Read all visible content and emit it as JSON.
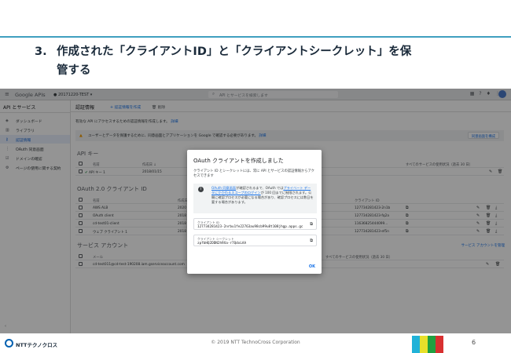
{
  "slide": {
    "title_number": "3.",
    "title_line1": "作成された「クライアントID」と「クライアントシークレット」を保",
    "title_line2": "管する"
  },
  "console": {
    "product": "Google APIs",
    "project": "20171220-TEST",
    "search_placeholder": "API とサービスを検索します",
    "sidebar": {
      "title": "API とサービス",
      "items": [
        {
          "label": "ダッシュボード",
          "icon": "dashboard-icon",
          "glyph": "◈"
        },
        {
          "label": "ライブラリ",
          "icon": "library-icon",
          "glyph": "▥"
        },
        {
          "label": "認証情報",
          "icon": "key-icon",
          "glyph": "⚷"
        },
        {
          "label": "OAuth 同意画面",
          "icon": "consent-icon",
          "glyph": "⋮"
        },
        {
          "label": "ドメインの確認",
          "icon": "checkbox-icon",
          "glyph": "☑"
        },
        {
          "label": "ページの使用に関する契約",
          "icon": "settings-icon",
          "glyph": "⚙"
        }
      ],
      "collapse_icon": "‹"
    },
    "header": {
      "title": "認証情報",
      "create": "+ 認証情報を作成",
      "delete": "🗑 削除"
    },
    "description": "有効な API にアクセスするための認証情報を作成します。",
    "description_link": "詳細",
    "notice": "ユーザーとデータを保護するために、同意画面とアプリケーションを Google で確認する必要があります。",
    "notice_link": "詳細",
    "notice_button": "同意画面を構成",
    "api_keys": {
      "title": "API キー",
      "headers": {
        "name": "名前",
        "created": "作成日 ↓",
        "restrictions": "制限",
        "usage": "すべてのサービスの使用状況（過去 30 日）"
      },
      "rows": [
        {
          "name": "API キー 1",
          "created": "2018/01/15"
        }
      ]
    },
    "oauth": {
      "title": "OAuth 2.0 クライアント ID",
      "headers": {
        "name": "名前",
        "created": "作成日",
        "client_id": "クライアント ID"
      },
      "rows": [
        {
          "name": "AWS ALB",
          "created": "2020",
          "client_id": "127734281423-2n1b"
        },
        {
          "name": "OAuth client",
          "created": "2018",
          "client_id": "127734281423-fq2a"
        },
        {
          "name": "cd-test01-client",
          "created": "2018",
          "client_id": "11636825444099..."
        },
        {
          "name": "ウェブ クライアント 1",
          "created": "2018",
          "client_id": "127734281423-ef5n"
        }
      ]
    },
    "service_accounts": {
      "title": "サービス アカウント",
      "manage_link": "サービス アカウントを管理",
      "headers": {
        "email": "メール",
        "usage": "すべてのサービスの使用状況（過去 30 日）"
      },
      "rows": [
        {
          "email": "cd-test011@cd-test-190208.iam.gserviceaccount.com"
        }
      ]
    }
  },
  "dialog": {
    "title": "OAuth クライアントを作成しました",
    "description": "クライアント ID とシークレットには、常に API とサービスの認証情報からアクセスできます",
    "info_part1": "OAuth 同意画面",
    "info_part2": "が確認されるまで、OAuth では",
    "info_part3": "プライベート データにかかわるスコープのログイン",
    "info_part4": "が 100 回までに制限されます。公開に確認プロセスが必要になる場合があり、確認プロセスには数日を要する場合があります。",
    "client_id_label": "クライアント ID",
    "client_id_value": "127734281423-2nrbu1fe22763au98cb99u8t108jhgp.apps.gc",
    "client_secret_label": "クライアント シークレット",
    "client_secret_value": "zpfbHQ2DDN2h9Xa-r7QdxLAA",
    "ok": "OK"
  },
  "footer": {
    "brand": "NTTテクノクロス",
    "copyright": "© 2019 NTT TechnoCross Corporation",
    "page": "6",
    "bar_colors": [
      "#20b2d8",
      "#e8e02a",
      "#20a040",
      "#d83030"
    ]
  }
}
